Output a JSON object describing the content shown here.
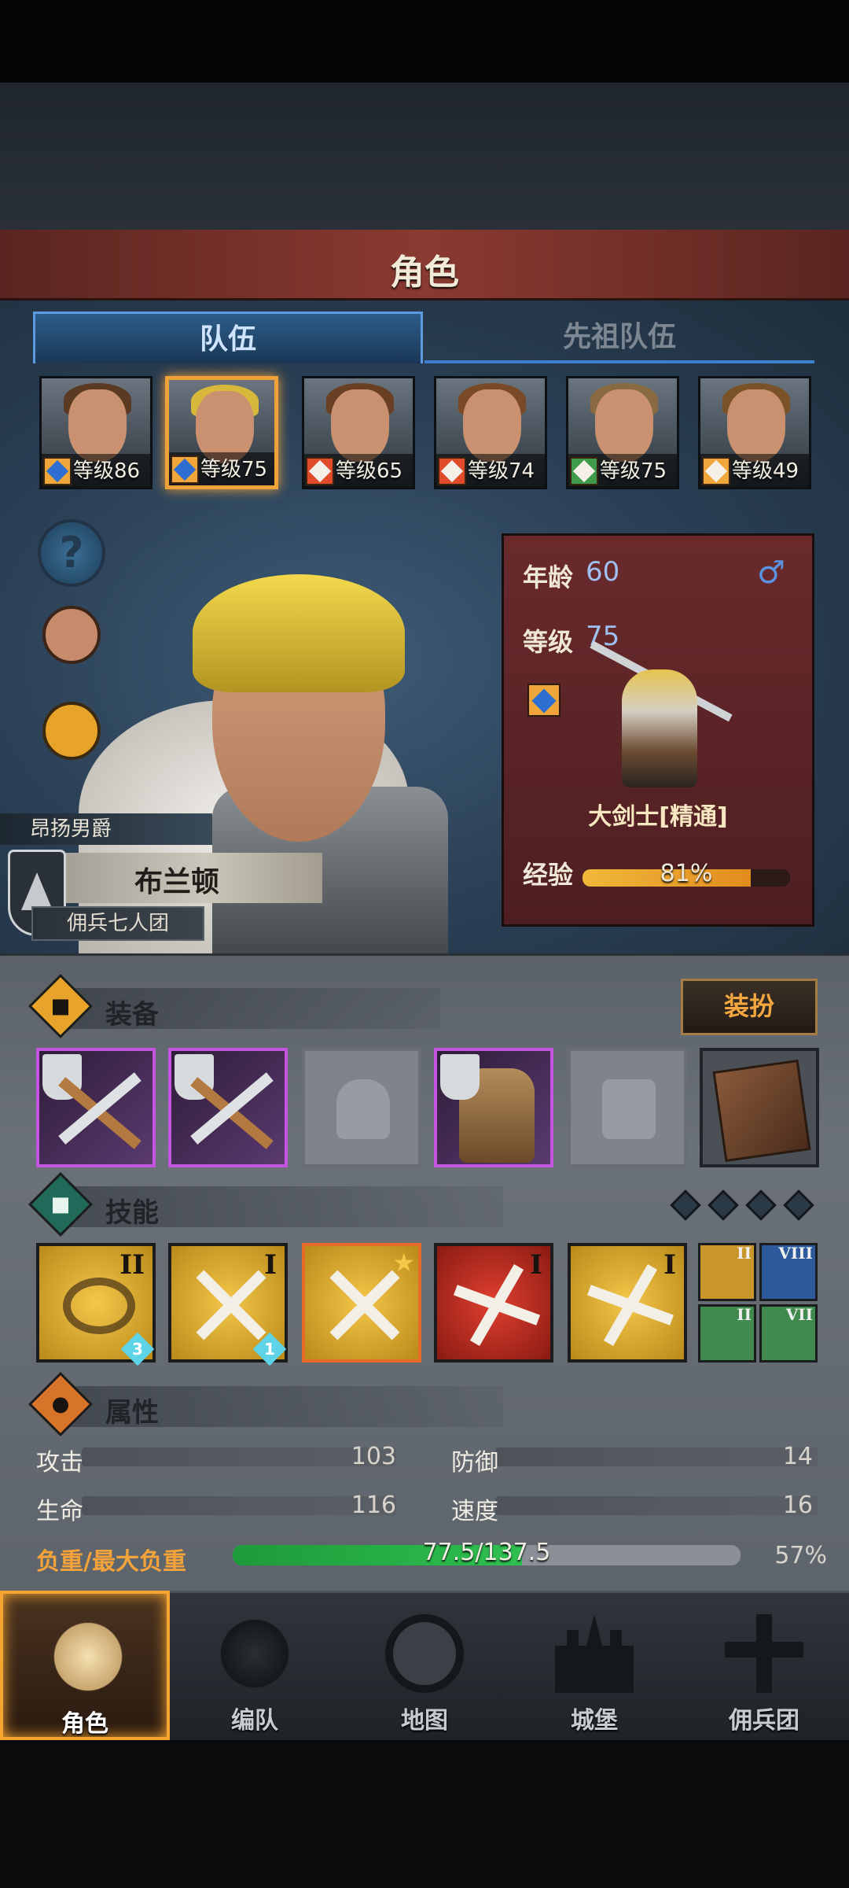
{
  "header": {
    "title": "角色"
  },
  "tabs": [
    {
      "label": "队伍",
      "active": true
    },
    {
      "label": "先祖队伍",
      "active": false
    }
  ],
  "party": [
    {
      "level": "等级86",
      "hair": "#5a3a22"
    },
    {
      "level": "等级75",
      "hair": "#d8b83a",
      "selected": true
    },
    {
      "level": "等级65",
      "hair": "#6a4024"
    },
    {
      "level": "等级74",
      "hair": "#7a4a28"
    },
    {
      "level": "等级75",
      "hair": "#8a6a40"
    },
    {
      "level": "等级49",
      "hair": "#7a5228"
    }
  ],
  "character": {
    "title": "昂扬男爵",
    "name": "布兰顿",
    "guild": "佣兵七人团",
    "age_label": "年龄",
    "age": "60",
    "gender_icon": "♂",
    "level_label": "等级",
    "level": "75",
    "class_name": "大剑士[精通]",
    "xp_label": "经验",
    "xp_text": "81%",
    "xp_fraction": 0.81
  },
  "equipment": {
    "title": "装备",
    "dress_button": "装扮",
    "slots": [
      "greatsword",
      "greatsword",
      "helmet-empty",
      "armor",
      "boots-empty",
      "book"
    ]
  },
  "skills": {
    "title": "技能",
    "items": [
      {
        "rank": "II",
        "level": "3",
        "style": "gold"
      },
      {
        "rank": "I",
        "level": "1",
        "style": "gold"
      },
      {
        "rank": "",
        "style": "gold-star"
      },
      {
        "rank": "I",
        "style": "red"
      },
      {
        "rank": "I",
        "style": "gold"
      }
    ],
    "mini": [
      {
        "rank": "II",
        "color": "#c8962a"
      },
      {
        "rank": "VIII",
        "color": "#2c5a9c"
      },
      {
        "rank": "II",
        "color": "#3f8a4c"
      },
      {
        "rank": "VII",
        "color": "#3f8a4c"
      }
    ]
  },
  "attributes": {
    "title": "属性",
    "attack_label": "攻击",
    "attack": "103",
    "defense_label": "防御",
    "defense": "14",
    "hp_label": "生命",
    "hp": "116",
    "speed_label": "速度",
    "speed": "16",
    "load_label": "负重/最大负重",
    "load_text": "77.5/137.5",
    "load_percent": "57%",
    "load_fraction": 0.57
  },
  "nav": [
    {
      "label": "角色",
      "active": true
    },
    {
      "label": "编队"
    },
    {
      "label": "地图"
    },
    {
      "label": "城堡"
    },
    {
      "label": "佣兵团"
    }
  ],
  "colors": {
    "accent": "#f5a530",
    "tab_blue": "#3f7fd0",
    "xp": "#f0b83a",
    "load": "#2fc050"
  }
}
